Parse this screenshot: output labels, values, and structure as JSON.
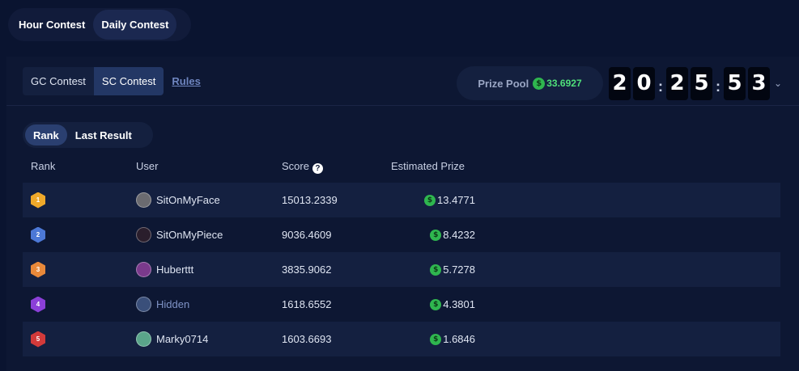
{
  "top_tabs": [
    {
      "label": "Hour Contest",
      "active": false
    },
    {
      "label": "Daily Contest",
      "active": true
    }
  ],
  "sub_tabs": [
    {
      "label": "GC Contest",
      "active": false
    },
    {
      "label": "SC Contest",
      "active": true
    }
  ],
  "rules_label": "Rules",
  "prize_pool": {
    "label": "Prize Pool",
    "amount": "33.6927",
    "coin_symbol": "$"
  },
  "timer": {
    "digits": [
      "2",
      "0",
      "2",
      "5",
      "5",
      "3"
    ],
    "separator": ":"
  },
  "rank_tabs": [
    {
      "label": "Rank",
      "active": true
    },
    {
      "label": "Last Result",
      "active": false
    }
  ],
  "columns": {
    "rank": "Rank",
    "user": "User",
    "score": "Score",
    "prize": "Estimated Prize",
    "help_icon": "?"
  },
  "rows": [
    {
      "rank": "1",
      "user": "SitOnMyFace",
      "score": "15013.2339",
      "prize": "13.4771",
      "medal_color": "#f0a92a",
      "avatar_color": "#6b6b70",
      "hidden": false
    },
    {
      "rank": "2",
      "user": "SitOnMyPiece",
      "score": "9036.4609",
      "prize": "8.4232",
      "medal_color": "#4c78d6",
      "avatar_color": "#2a1e2c",
      "hidden": false
    },
    {
      "rank": "3",
      "user": "Huberttt",
      "score": "3835.9062",
      "prize": "5.7278",
      "medal_color": "#e9893a",
      "avatar_color": "#7a3a8c",
      "hidden": false
    },
    {
      "rank": "4",
      "user": "Hidden",
      "score": "1618.6552",
      "prize": "4.3801",
      "medal_color": "#8b3fd8",
      "avatar_color": "#3a4f7a",
      "hidden": true
    },
    {
      "rank": "5",
      "user": "Marky0714",
      "score": "1603.6693",
      "prize": "1.6846",
      "medal_color": "#d23a3a",
      "avatar_color": "#5aa58a",
      "hidden": false
    }
  ]
}
